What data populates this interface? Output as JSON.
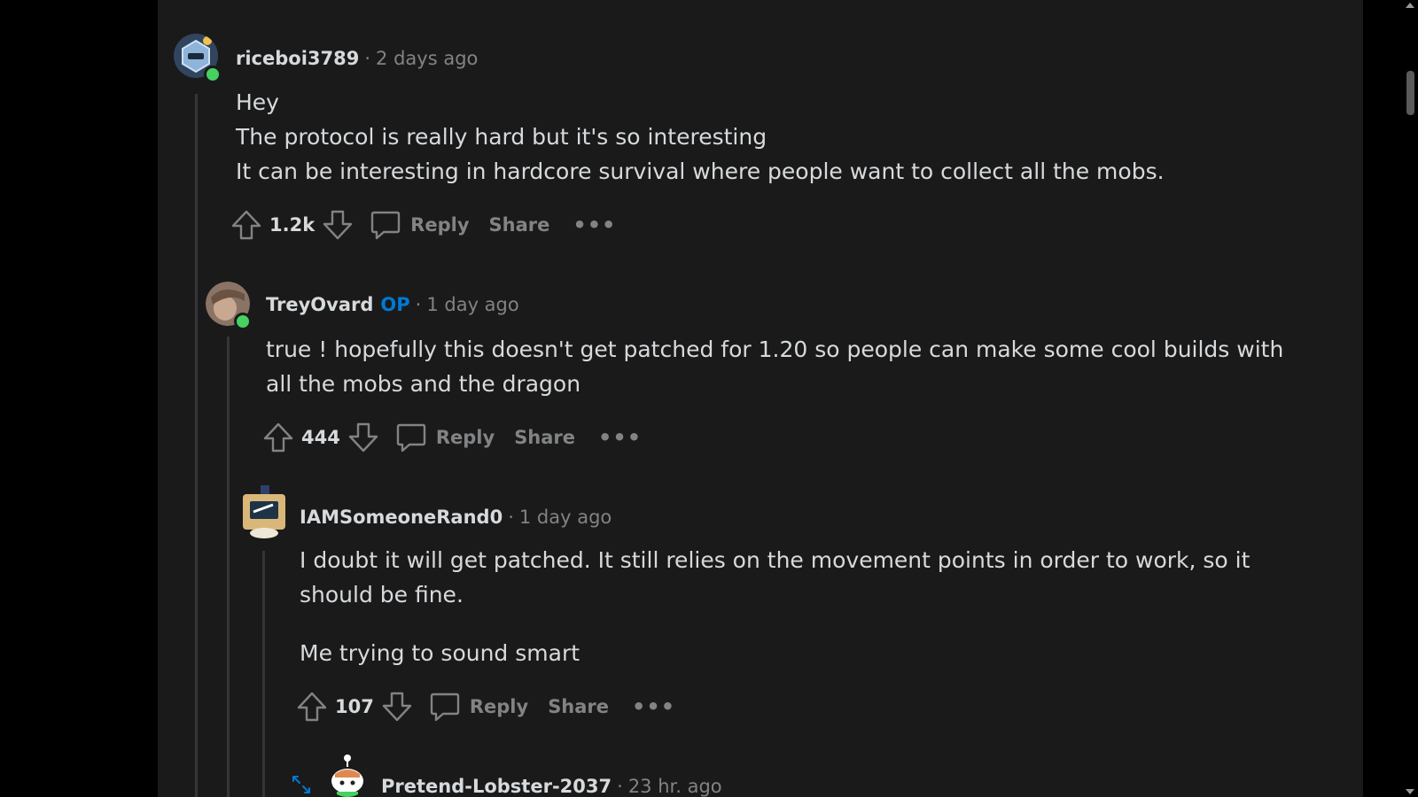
{
  "comments": [
    {
      "username": "riceboi3789",
      "op_badge": "",
      "separator": "·",
      "time": "2 days ago",
      "body": [
        "Hey",
        "The protocol is really hard but it's so interesting",
        "It can be interesting in hardcore survival where people want to collect all the mobs."
      ],
      "score": "1.2k",
      "reply_label": "Reply",
      "share_label": "Share",
      "more_label": "•••"
    },
    {
      "username": "TreyOvard",
      "op_badge": "OP",
      "separator": "·",
      "time": "1 day ago",
      "body": [
        "true ! hopefully this doesn't get patched for 1.20 so people can make some cool builds with all the mobs and the dragon"
      ],
      "score": "444",
      "reply_label": "Reply",
      "share_label": "Share",
      "more_label": "•••"
    },
    {
      "username": "IAMSomeoneRand0",
      "op_badge": "",
      "separator": "·",
      "time": "1 day ago",
      "body": [
        "I doubt it will get patched. It still relies on the movement points in order to work, so it should be fine.",
        "Me trying to sound smart"
      ],
      "score": "107",
      "reply_label": "Reply",
      "share_label": "Share",
      "more_label": "•••"
    },
    {
      "username": "Pretend-Lobster-2037",
      "op_badge": "",
      "separator": "·",
      "time": "23 hr. ago"
    }
  ],
  "icons": {
    "upvote": "upvote-arrow-icon",
    "downvote": "downvote-arrow-icon",
    "reply": "speech-bubble-icon",
    "expand": "expand-arrows-icon"
  },
  "colors": {
    "background": "#1a1a1b",
    "text": "#d7dadc",
    "muted": "#818384",
    "op": "#0079d3",
    "online": "#46d160"
  }
}
